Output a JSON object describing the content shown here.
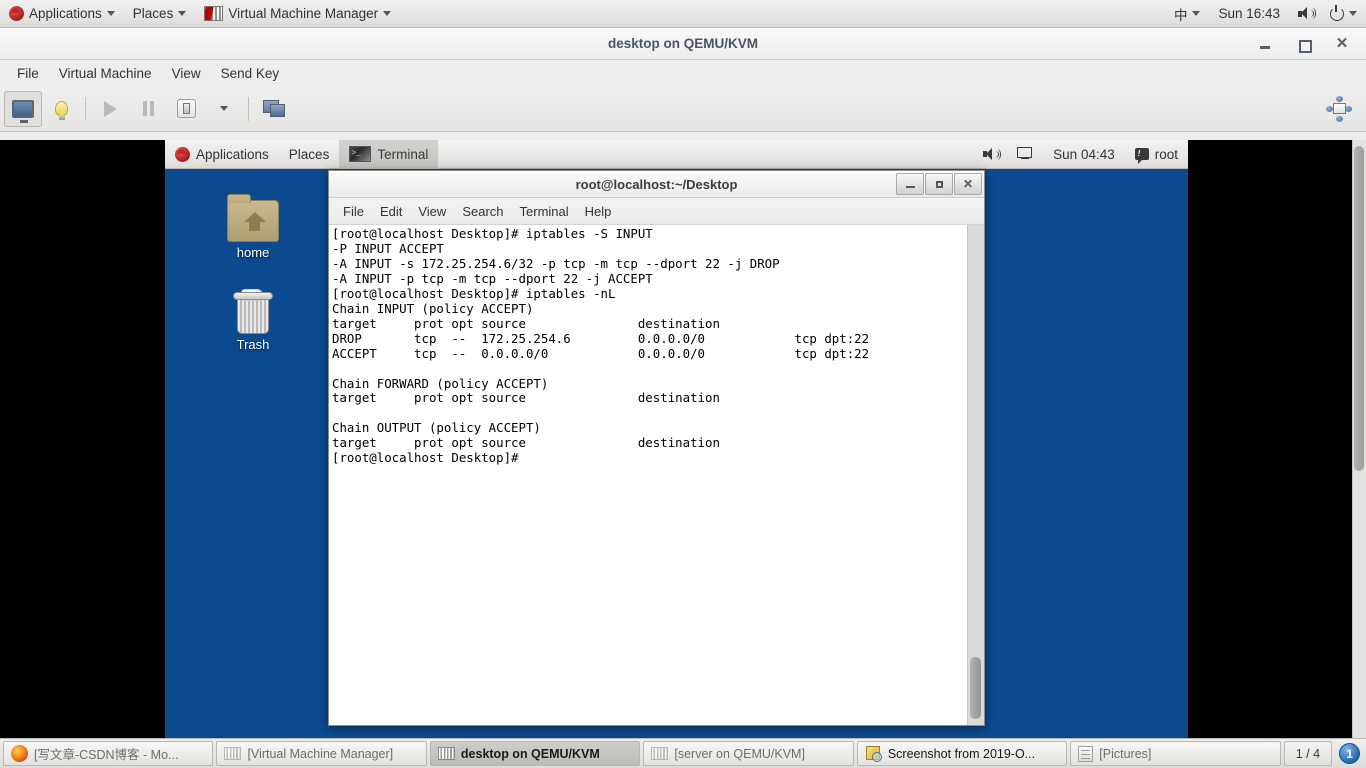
{
  "host_panel": {
    "applications": "Applications",
    "places": "Places",
    "active_app": "Virtual Machine Manager",
    "input_method": "中",
    "clock": "Sun 16:43",
    "icons": [
      "redhat-icon",
      "chevron-down-icon",
      "vmm-icon",
      "volume-icon",
      "power-icon"
    ]
  },
  "vmm_window": {
    "title": "desktop on QEMU/KVM",
    "menu": [
      "File",
      "Virtual Machine",
      "View",
      "Send Key"
    ],
    "toolbar": [
      {
        "name": "show-graphical-console",
        "icon": "monitor-icon",
        "active": true
      },
      {
        "name": "show-virtual-hardware-details",
        "icon": "lightbulb-icon",
        "active": false
      },
      {
        "name": "run-vm",
        "icon": "play-icon",
        "active": false
      },
      {
        "name": "pause-vm",
        "icon": "pause-icon",
        "active": false
      },
      {
        "name": "shutdown-vm",
        "icon": "shutdown-icon",
        "active": false
      },
      {
        "name": "shutdown-options",
        "icon": "chevron-down-icon",
        "active": false
      },
      {
        "name": "snapshots",
        "icon": "screens-icon",
        "active": false
      },
      {
        "name": "fullscreen",
        "icon": "fullscreen-icon",
        "active": false
      }
    ],
    "window_buttons": [
      "minimize",
      "maximize",
      "close"
    ]
  },
  "guest": {
    "panel": {
      "applications": "Applications",
      "places": "Places",
      "window_title": "Terminal",
      "clock": "Sun 04:43",
      "user": "root",
      "icons": [
        "redhat-icon",
        "terminal-icon",
        "volume-icon",
        "network-disconnected-icon",
        "chat-icon"
      ]
    },
    "desktop_icons": [
      {
        "label": "home",
        "icon": "home-folder-icon"
      },
      {
        "label": "Trash",
        "icon": "trash-icon"
      }
    ],
    "terminal": {
      "title": "root@localhost:~/Desktop",
      "menu": [
        "File",
        "Edit",
        "View",
        "Search",
        "Terminal",
        "Help"
      ],
      "window_buttons": [
        "minimize",
        "maximize",
        "close"
      ],
      "content": "[root@localhost Desktop]# iptables -S INPUT\n-P INPUT ACCEPT\n-A INPUT -s 172.25.254.6/32 -p tcp -m tcp --dport 22 -j DROP\n-A INPUT -p tcp -m tcp --dport 22 -j ACCEPT\n[root@localhost Desktop]# iptables -nL\nChain INPUT (policy ACCEPT)\ntarget     prot opt source               destination\nDROP       tcp  --  172.25.254.6         0.0.0.0/0            tcp dpt:22\nACCEPT     tcp  --  0.0.0.0/0            0.0.0.0/0            tcp dpt:22\n\nChain FORWARD (policy ACCEPT)\ntarget     prot opt source               destination\n\nChain OUTPUT (policy ACCEPT)\ntarget     prot opt source               destination\n[root@localhost Desktop]#"
    }
  },
  "taskbar": {
    "items": [
      {
        "label": "[写文章-CSDN博客 - Mo...",
        "icon": "firefox-icon",
        "active": false
      },
      {
        "label": "[Virtual Machine Manager]",
        "icon": "vmm-icon",
        "active": false
      },
      {
        "label": "desktop on QEMU/KVM",
        "icon": "vmm-icon",
        "active": true
      },
      {
        "label": "[server on QEMU/KVM]",
        "icon": "vmm-icon",
        "active": false
      },
      {
        "label": "Screenshot from 2019-O...",
        "icon": "screenshot-icon",
        "active": false
      },
      {
        "label": "[Pictures]",
        "icon": "pictures-icon",
        "active": false
      }
    ],
    "workspace_count": "1 / 4",
    "workspace_current": "1"
  },
  "colors": {
    "desktop_blue": "#0b4a8f",
    "panel_grey": "#ededed",
    "terminal_bg": "#ffffff",
    "terminal_fg": "#000000"
  }
}
